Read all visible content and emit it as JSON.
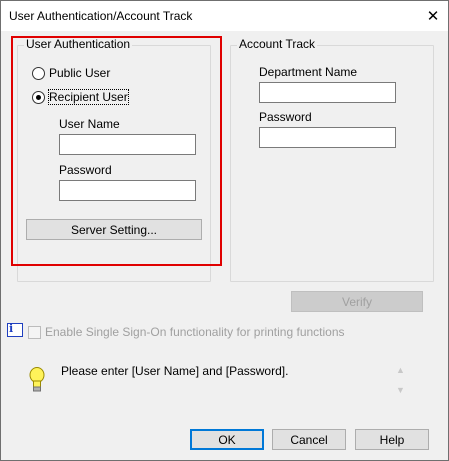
{
  "window": {
    "title": "User Authentication/Account Track"
  },
  "user_auth": {
    "group_label": "User Authentication",
    "public_user": "Public User",
    "recipient_user": "Recipient User",
    "selected": "recipient_user",
    "user_name_label": "User Name",
    "user_name_value": "",
    "password_label": "Password",
    "password_value": "",
    "server_setting_button": "Server Setting..."
  },
  "account_track": {
    "group_label": "Account Track",
    "department_name_label": "Department Name",
    "department_name_value": "",
    "password_label": "Password",
    "password_value": ""
  },
  "verify_button": "Verify",
  "sso": {
    "label": "Enable Single Sign-On functionality for printing functions",
    "checked": false,
    "enabled": false
  },
  "message": "Please enter [User Name] and [Password].",
  "buttons": {
    "ok": "OK",
    "cancel": "Cancel",
    "help": "Help"
  },
  "colors": {
    "highlight": "#e00000",
    "focus_border": "#0078d7"
  }
}
